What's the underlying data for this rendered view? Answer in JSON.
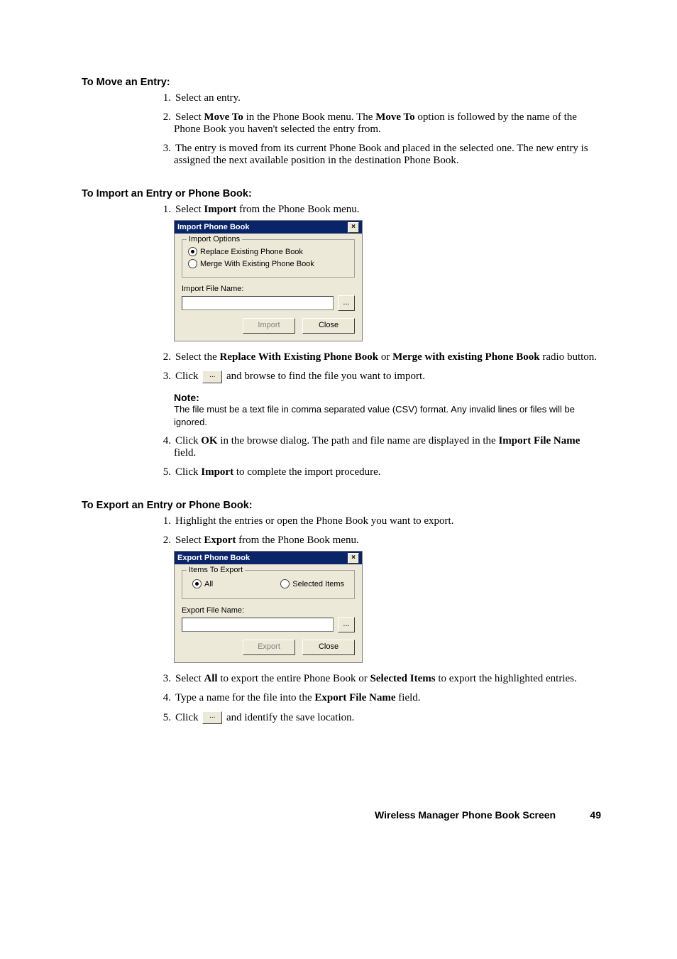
{
  "sections": {
    "move": {
      "heading": "To Move an Entry:",
      "step1": "Select an entry.",
      "step2a": "Select ",
      "step2b": "Move To",
      "step2c": " in the Phone Book menu. The ",
      "step2d": "Move To",
      "step2e": " option is followed by the name of the Phone Book you haven't selected the entry from.",
      "step3": "The entry is moved from its current Phone Book and placed in the selected one. The new entry is assigned the next available position in the destination Phone Book."
    },
    "import": {
      "heading": "To Import an Entry or Phone Book:",
      "step1a": "Select ",
      "step1b": "Import",
      "step1c": " from the Phone Book menu.",
      "step2a": "Select the ",
      "step2b": "Replace With Existing Phone Book",
      "step2c": " or ",
      "step2d": "Merge with existing Phone Book",
      "step2e": " radio button.",
      "step3a": "Click ",
      "step3b": " and browse to find the file you want to import.",
      "note_title": "Note:",
      "note_text": "The file must be a text file in comma separated value (CSV) format. Any invalid lines or files will be ignored.",
      "step4a": "Click ",
      "step4b": "OK",
      "step4c": " in the browse dialog. The path and file name are displayed in the ",
      "step4d": "Import File Name",
      "step4e": " field.",
      "step5a": "Click ",
      "step5b": "Import",
      "step5c": " to complete the import procedure."
    },
    "export": {
      "heading": "To Export an Entry or Phone Book:",
      "step1": "Highlight the entries or open the Phone Book you want to export.",
      "step2a": "Select ",
      "step2b": "Export",
      "step2c": " from the Phone Book menu.",
      "step3a": "Select ",
      "step3b": "All",
      "step3c": " to export the entire Phone Book or ",
      "step3d": "Selected Items",
      "step3e": " to export the highlighted entries.",
      "step4a": "Type a name for the file into the ",
      "step4b": "Export File Name",
      "step4c": " field.",
      "step5a": "Click ",
      "step5b": " and identify the save location."
    }
  },
  "dialogs": {
    "import": {
      "title": "Import Phone Book",
      "group": "Import Options",
      "opt1": "Replace Existing Phone Book",
      "opt2": "Merge With Existing Phone Book",
      "file_label": "Import File Name:",
      "browse": "...",
      "btn_import": "Import",
      "btn_close": "Close"
    },
    "export": {
      "title": "Export Phone Book",
      "group": "Items To Export",
      "opt_all": "All",
      "opt_sel": "Selected Items",
      "file_label": "Export File Name:",
      "browse": "...",
      "btn_export": "Export",
      "btn_close": "Close"
    }
  },
  "inline_browse": "...",
  "footer": {
    "title": "Wireless Manager Phone Book Screen",
    "page": "49"
  }
}
